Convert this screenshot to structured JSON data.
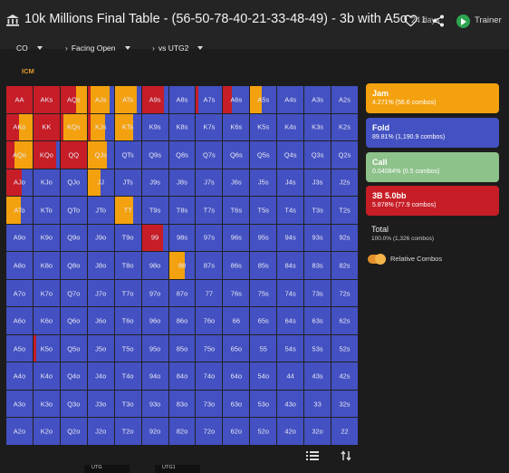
{
  "header": {
    "title": "10k Millions Final Table - (56-50-78-40-21-33-48-49) - 3b with A5o",
    "age": "24 days",
    "likes": "1",
    "trainer_label": "Trainer"
  },
  "filters": {
    "position": "CO",
    "action": "Facing Open",
    "vs": "vs UTG2"
  },
  "mode_label": "ICM",
  "colors": {
    "jam": "#f4a10f",
    "fold": "#4351c2",
    "call": "#8dc28a",
    "bet": "#c61d27"
  },
  "legend": [
    {
      "name": "Jam",
      "stats": "4.271% (56.6 combos)"
    },
    {
      "name": "Fold",
      "stats": "89.81% (1,190.9 combos)"
    },
    {
      "name": "Call",
      "stats": "0.04084% (0.5 combos)"
    },
    {
      "name": "3B 5.0bb",
      "stats": "5.878% (77.9 combos)"
    }
  ],
  "total": {
    "label": "Total",
    "stats": "100.0% (1,326 combos)"
  },
  "toggle_label": "Relative Combos",
  "seats": [
    "UTG",
    "UTG1"
  ],
  "grid": [
    [
      "AA",
      "AKs",
      "AQs",
      "AJs",
      "ATs",
      "A9s",
      "A8s",
      "A7s",
      "A6s",
      "A5s",
      "A4s",
      "A3s",
      "A2s"
    ],
    [
      "AKo",
      "KK",
      "KQs",
      "KJs",
      "KTs",
      "K9s",
      "K8s",
      "K7s",
      "K6s",
      "K5s",
      "K4s",
      "K3s",
      "K2s"
    ],
    [
      "AQo",
      "KQo",
      "QQ",
      "QJs",
      "QTs",
      "Q9s",
      "Q8s",
      "Q7s",
      "Q6s",
      "Q5s",
      "Q4s",
      "Q3s",
      "Q2s"
    ],
    [
      "AJo",
      "KJo",
      "QJo",
      "JJ",
      "JTs",
      "J9s",
      "J8s",
      "J7s",
      "J6s",
      "J5s",
      "J4s",
      "J3s",
      "J2s"
    ],
    [
      "ATo",
      "KTo",
      "QTo",
      "JTo",
      "TT",
      "T9s",
      "T8s",
      "T7s",
      "T6s",
      "T5s",
      "T4s",
      "T3s",
      "T2s"
    ],
    [
      "A9o",
      "K9o",
      "Q9o",
      "J9o",
      "T9o",
      "99",
      "98s",
      "97s",
      "96s",
      "95s",
      "94s",
      "93s",
      "92s"
    ],
    [
      "A8o",
      "K8o",
      "Q8o",
      "J8o",
      "T8o",
      "98o",
      "88",
      "87s",
      "86s",
      "85s",
      "84s",
      "83s",
      "82s"
    ],
    [
      "A7o",
      "K7o",
      "Q7o",
      "J7o",
      "T7o",
      "97o",
      "87o",
      "77",
      "76s",
      "75s",
      "74s",
      "73s",
      "72s"
    ],
    [
      "A6o",
      "K6o",
      "Q6o",
      "J6o",
      "T6o",
      "96o",
      "86o",
      "76o",
      "66",
      "65s",
      "64s",
      "63s",
      "62s"
    ],
    [
      "A5o",
      "K5o",
      "Q5o",
      "J5o",
      "T5o",
      "95o",
      "85o",
      "75o",
      "65o",
      "55",
      "54s",
      "53s",
      "52s"
    ],
    [
      "A4o",
      "K4o",
      "Q4o",
      "J4o",
      "T4o",
      "94o",
      "84o",
      "74o",
      "64o",
      "54o",
      "44",
      "43s",
      "42s"
    ],
    [
      "A3o",
      "K3o",
      "Q3o",
      "J3o",
      "T3o",
      "93o",
      "83o",
      "73o",
      "63o",
      "53o",
      "43o",
      "33",
      "32s"
    ],
    [
      "A2o",
      "K2o",
      "Q2o",
      "J2o",
      "T2o",
      "92o",
      "82o",
      "72o",
      "62o",
      "52o",
      "42o",
      "32o",
      "22"
    ]
  ],
  "frequencies": {
    "AA": {
      "bet": 1.0
    },
    "AKs": {
      "bet": 1.0
    },
    "AQs": {
      "bet": 0.6,
      "jam": 0.4
    },
    "AJs": {
      "jam": 0.75,
      "bet": 0.1
    },
    "ATs": {
      "jam": 0.85
    },
    "A9s": {
      "bet": 0.85
    },
    "A7s": {
      "bet": 0.08
    },
    "A6s": {
      "bet": 0.35
    },
    "A5s": {
      "jam": 0.45
    },
    "AKo": {
      "jam": 0.5,
      "bet": 0.5
    },
    "KK": {
      "bet": 1.0
    },
    "KQs": {
      "jam": 0.9,
      "bet": 0.1
    },
    "KJs": {
      "jam": 0.55,
      "bet": 0.1
    },
    "KTs": {
      "jam": 0.7
    },
    "AQo": {
      "jam": 0.7,
      "bet": 0.3
    },
    "KQo": {
      "bet": 0.85
    },
    "QQ": {
      "bet": 1.0
    },
    "QJs": {
      "jam": 0.75
    },
    "AJo": {
      "bet": 0.6
    },
    "JJ": {
      "jam": 0.5
    },
    "ATo": {
      "jam": 0.55
    },
    "TT": {
      "jam": 0.7
    },
    "99": {
      "bet": 0.8
    },
    "88": {
      "jam": 0.6
    },
    "K5o": {
      "bet": 0.1
    }
  }
}
